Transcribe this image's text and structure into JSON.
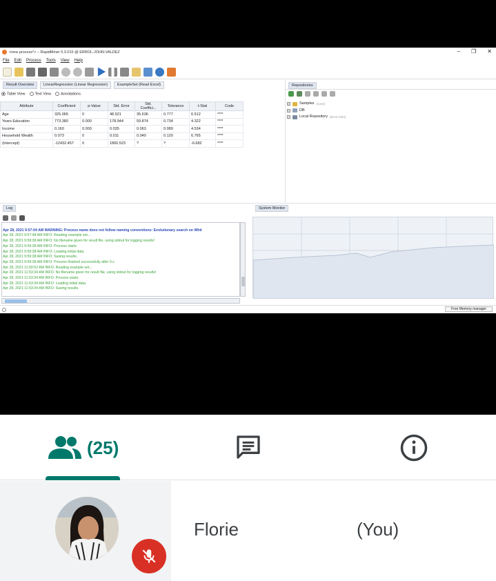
{
  "window": {
    "title": "<new process*> – RapidMiner 5.3.015 @ ERROL-JOHN-VALDEZ",
    "controls": [
      "–",
      "❐",
      "✕"
    ]
  },
  "menu": [
    "File",
    "Edit",
    "Process",
    "Tools",
    "View",
    "Help"
  ],
  "tabs": {
    "result_overview": "Result Overview",
    "linear_regression": "LinearRegression (Linear Regression)",
    "example_set": "ExampleSet (Read Excel)",
    "repositories": "Repositories",
    "log": "Log",
    "system_monitor": "System Monitor"
  },
  "view_options": {
    "table_view": "Table View",
    "text_view": "Text View",
    "annotations": "Annotations"
  },
  "table": {
    "headers": [
      "Attribute",
      "Coefficient",
      "p-Value",
      "Std. Error",
      "Std. Coeffici...",
      "Tolerance",
      "t-Stat",
      "Code"
    ],
    "rows": [
      [
        "Age",
        "325.065",
        "0",
        "48.921",
        "35.636",
        "0.777",
        "6.512",
        "****"
      ],
      [
        "Years Education",
        "773.380",
        "0.000",
        "178.944",
        "59.874",
        "0.734",
        "4.322",
        "****"
      ],
      [
        "Income",
        "0.160",
        "0.000",
        "0.035",
        "0.063",
        "0.089",
        "4.534",
        "****"
      ],
      [
        "Household Wealth",
        "0.073",
        "0",
        "0.011",
        "0.040",
        "0.120",
        "6.765",
        "****"
      ],
      [
        "(Intercept)",
        "-12432.457",
        "0",
        "1860.523",
        "?",
        "?",
        "-6.682",
        "****"
      ]
    ]
  },
  "repositories": {
    "samples": "Samples",
    "samples_note": "(none)",
    "db": "DB",
    "local": "Local Repository",
    "local_note": "(Errol John)"
  },
  "log": {
    "lines": [
      {
        "text": "Apr 28, 2021 9:57:04 AM WARNING: Process name does not follow naming conventions: Evolutionary search on Whit",
        "kind": "warn"
      },
      {
        "text": "Apr 28, 2021 9:57:48 AM INFO: Reading example set...",
        "kind": "info"
      },
      {
        "text": "Apr 28, 2021 9:59:38 AM INFO: No filename given for result file, using stdout for logging results!",
        "kind": "info"
      },
      {
        "text": "Apr 28, 2021 9:59:38 AM INFO: Process starts",
        "kind": "info"
      },
      {
        "text": "Apr 28, 2021 9:59:38 AM INFO: Loading initial data.",
        "kind": "info"
      },
      {
        "text": "Apr 28, 2021 9:59:38 AM INFO: Saving results.",
        "kind": "info"
      },
      {
        "text": "Apr 28, 2021 9:59:38 AM INFO: Process finished successfully after 0 s",
        "kind": "info"
      },
      {
        "text": "Apr 28, 2021 11:50:52 AM INFO: Reading example set...",
        "kind": "info"
      },
      {
        "text": "Apr 28, 2021 11:53:34 AM INFO: No filename given for result file, using stdout for logging results!",
        "kind": "info"
      },
      {
        "text": "Apr 28, 2021 11:53:34 AM INFO: Process starts",
        "kind": "info"
      },
      {
        "text": "Apr 28, 2021 11:53:34 AM INFO: Loading initial data.",
        "kind": "info"
      },
      {
        "text": "Apr 28, 2021 11:53:34 AM INFO: Saving results.",
        "kind": "info"
      }
    ]
  },
  "status": {
    "memory_button": "Free Memory manager"
  },
  "meet": {
    "participants_count": "(25)",
    "participant_name": "Florie",
    "you_label": "(You)",
    "accent_color": "#00796b",
    "mic_off_color": "#d93025"
  }
}
